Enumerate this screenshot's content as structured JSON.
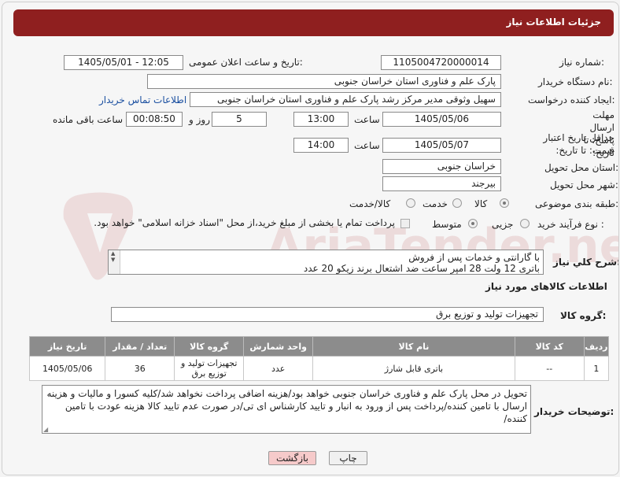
{
  "header": {
    "title": "جزئیات اطلاعات نیاز"
  },
  "fields": {
    "need_number_label": "شماره نیاز:",
    "need_number": "1105004720000014",
    "announce_label": "تاریخ و ساعت اعلان عمومی:",
    "announce_value": "1405/05/01 - 12:05",
    "buyer_org_label": "نام دستگاه خریدار:",
    "buyer_org": "پارک علم و فناوری استان خراسان جنوبی",
    "requester_label": "ایجاد کننده درخواست:",
    "requester": "سهیل وثوقی مدیر مرکز رشد پارک علم و فناوری استان خراسان جنوبی",
    "buyer_contact_link": "اطلاعات تماس خریدار",
    "deadline_label": "مهلت ارسال پاسخ: تا تاریخ:",
    "deadline_date": "1405/05/06",
    "time_label": "ساعت",
    "deadline_time": "13:00",
    "days_value": "5",
    "day_and_label": "روز و",
    "remaining_time": "00:08:50",
    "remaining_label": "ساعت باقی مانده",
    "price_validity_label": "حداقل تاریخ اعتبار قیمت: تا تاریخ:",
    "price_date": "1405/05/07",
    "price_time": "14:00",
    "delivery_province_label": "استان محل تحویل:",
    "delivery_province": "خراسان جنوبی",
    "delivery_city_label": "شهر محل تحویل:",
    "delivery_city": "بیرجند",
    "category_label": "طبقه بندی موضوعی:",
    "category_options": [
      "کالا",
      "خدمت",
      "کالا/خدمت"
    ],
    "process_label": "نوع فرآیند خرید :",
    "process_options": [
      "جزیی",
      "متوسط"
    ],
    "payment_note": "پرداخت تمام یا بخشی از مبلغ خرید،از محل \"اسناد خزانه اسلامی\" خواهد بود."
  },
  "description": {
    "label": "شرح کلي نياز:",
    "line1": "با گارانتی و خدمات پس از فروش",
    "line2": "باتری 12 ولت 28 امپر ساعت ضد اشتعال برند زیکو 20 عدد"
  },
  "goods_info": {
    "title": "اطلاعات کالاهای مورد نیاز",
    "group_label": "گروه کالا:",
    "group_value": "تجهیزات تولید و توزیع برق"
  },
  "table": {
    "headers": [
      "ردیف",
      "کد کالا",
      "نام کالا",
      "واحد شمارش",
      "گروه کالا",
      "تعداد / مقدار",
      "تاریخ نیاز"
    ],
    "rows": [
      [
        "1",
        "--",
        "باتری قابل شارژ",
        "عدد",
        "تجهیزات تولید و توزیع برق",
        "36",
        "1405/05/06"
      ]
    ]
  },
  "buyer_notes": {
    "label": "توضیحات خریدار:",
    "text": "تحویل در محل پارک علم و فناوری خراسان جنوبی خواهد بود/هزینه اضافی پرداخت نخواهد شد/کلیه کسورا و مالیات و هزینه ارسال با تامین کننده/پرداخت پس از ورود به انبار و تایید کارشناس ای تی/در صورت عدم تایید کالا هزینه عودت با تامین کننده/"
  },
  "buttons": {
    "print": "چاپ",
    "back": "بازگشت"
  },
  "watermark": "AriaTender.net",
  "colors": {
    "header": "#8f1f1f",
    "table_header": "#8c8c8c",
    "back_button": "#f6caca"
  }
}
